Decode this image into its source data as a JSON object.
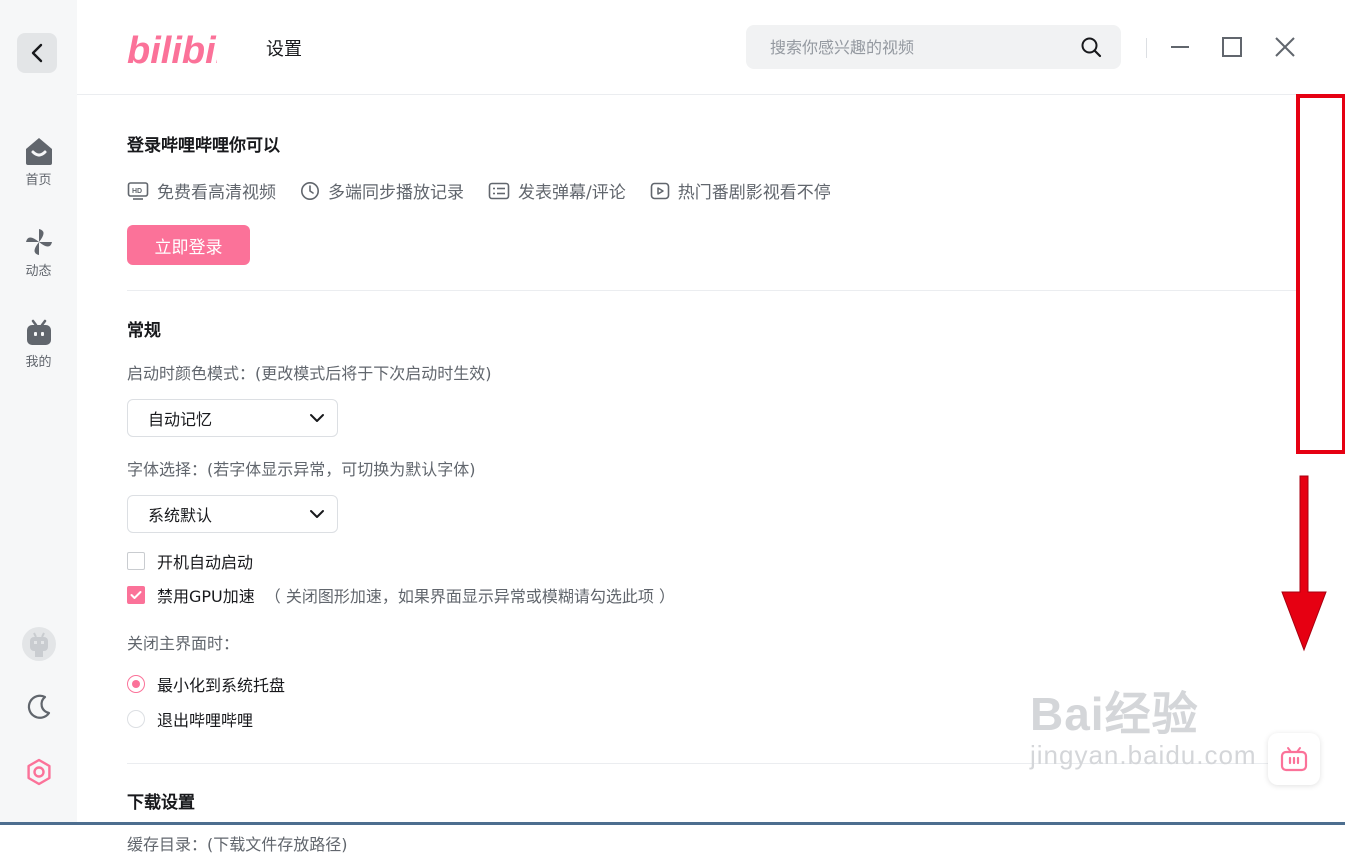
{
  "app": {
    "logo_text": "bilibili",
    "page_title": "设置"
  },
  "search": {
    "placeholder": "搜索你感兴趣的视频"
  },
  "sidebar": {
    "items": [
      {
        "label": "首页",
        "icon": "home-icon"
      },
      {
        "label": "动态",
        "icon": "pinwheel-icon"
      },
      {
        "label": "我的",
        "icon": "tv-icon"
      }
    ]
  },
  "login": {
    "title": "登录哔哩哔哩你可以",
    "features": [
      "免费看高清视频",
      "多端同步播放记录",
      "发表弹幕/评论",
      "热门番剧影视看不停"
    ],
    "button": "立即登录"
  },
  "general": {
    "title": "常规",
    "color_mode_label": "启动时颜色模式：(更改模式后将于下次启动时生效)",
    "color_mode_value": "自动记忆",
    "font_label": "字体选择：(若字体显示异常，可切换为默认字体)",
    "font_value": "系统默认",
    "autostart": {
      "label": "开机自动启动",
      "checked": false
    },
    "disable_gpu": {
      "label": "禁用GPU加速",
      "hint": "（ 关闭图形加速，如果界面显示异常或模糊请勾选此项 ）",
      "checked": true
    },
    "close_label": "关闭主界面时：",
    "close_options": [
      {
        "label": "最小化到系统托盘",
        "checked": true
      },
      {
        "label": "退出哔哩哔哩",
        "checked": false
      }
    ]
  },
  "download": {
    "title": "下载设置",
    "cache_label": "缓存目录：(下载文件存放路径)"
  },
  "watermark": {
    "main": "Bai经验",
    "sub": "jingyan.baidu.com"
  },
  "colors": {
    "accent": "#fb7299",
    "annotation": "#e60012"
  }
}
